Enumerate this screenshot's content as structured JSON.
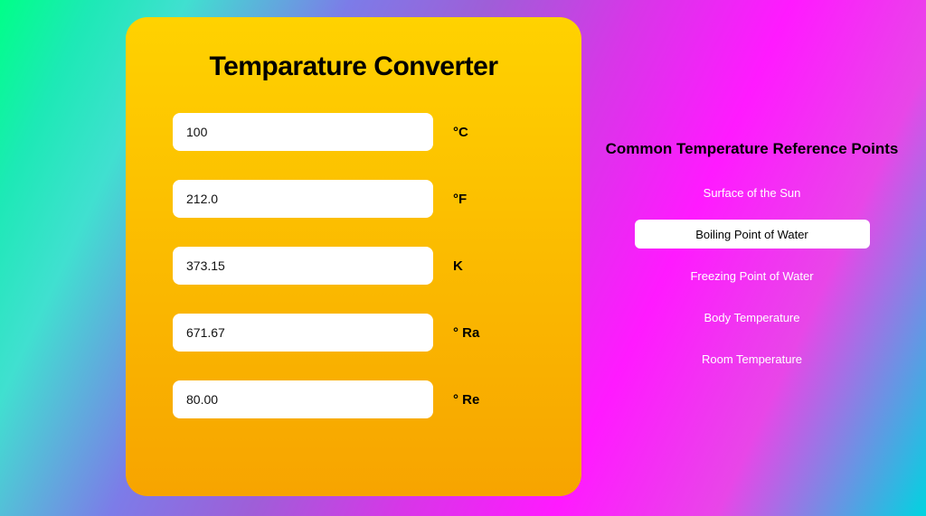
{
  "converter": {
    "title": "Temparature Converter",
    "fields": [
      {
        "value": "100",
        "unit": "°C"
      },
      {
        "value": "212.0",
        "unit": "°F"
      },
      {
        "value": "373.15",
        "unit": "K"
      },
      {
        "value": "671.67",
        "unit": "° Ra"
      },
      {
        "value": "80.00",
        "unit": "° Re"
      }
    ]
  },
  "reference": {
    "title": "Common Temperature Reference Points",
    "items": [
      {
        "label": "Surface of the Sun",
        "active": false
      },
      {
        "label": "Boiling Point of Water",
        "active": true
      },
      {
        "label": "Freezing Point of Water",
        "active": false
      },
      {
        "label": "Body Temperature",
        "active": false
      },
      {
        "label": "Room Temperature",
        "active": false
      }
    ]
  }
}
